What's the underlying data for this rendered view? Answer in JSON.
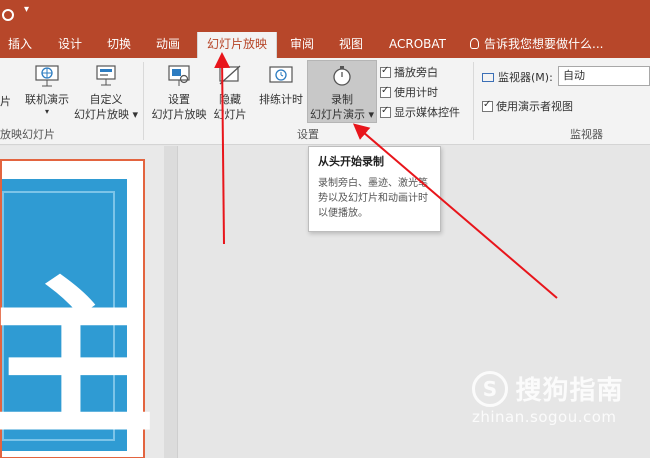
{
  "tabs": [
    "插入",
    "设计",
    "切换",
    "动画",
    "幻灯片放映",
    "审阅",
    "视图",
    "ACROBAT"
  ],
  "tell_me": "告诉我您想要做什么...",
  "ribbon": {
    "partial_left_btn": "片",
    "online_present": "联机演示",
    "custom_show_line1": "自定义",
    "custom_show_line2": "幻灯片放映",
    "setup_line1": "设置",
    "setup_line2": "幻灯片放映",
    "hide_line1": "隐藏",
    "hide_line2": "幻灯片",
    "rehearse": "排练计时",
    "record_line1": "录制",
    "record_line2": "幻灯片演示",
    "play_narrations": "播放旁白",
    "use_timings": "使用计时",
    "show_media": "显示媒体控件",
    "group_start": "放映幻灯片",
    "group_setup": "设置",
    "monitor_label": "监视器(M):",
    "monitor_value": "自动",
    "presenter_view": "使用演示者视图",
    "group_monitors": "监视器"
  },
  "tooltip": {
    "title": "从头开始录制",
    "body": "录制旁白、墨迹、激光笔势以及幻灯片和动画计时以便播放。"
  },
  "slide": {
    "character": "主"
  },
  "watermark": {
    "name": "搜狗指南",
    "url": "zhinan.sogou.com"
  },
  "colors": {
    "accent": "#b7472a",
    "slide_blue": "#2f9bd3",
    "arrow": "#e8151b"
  }
}
